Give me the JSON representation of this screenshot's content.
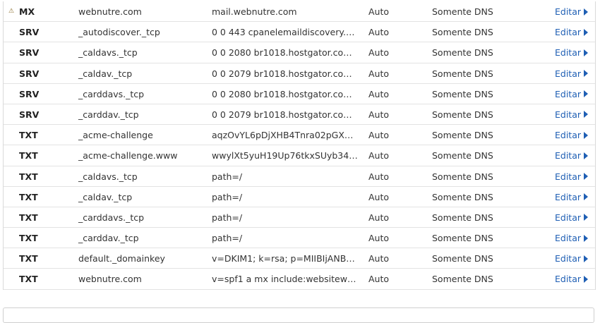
{
  "dns_table": {
    "edit_label": "Editar",
    "warning_icon": "⚠",
    "rows": [
      {
        "warning": true,
        "type": "MX",
        "name": "webnutre.com",
        "value": "mail.webnutre.com",
        "ttl": "Auto",
        "status": "Somente DNS"
      },
      {
        "warning": false,
        "type": "SRV",
        "name": "_autodiscover._tcp",
        "value": "0 0 443 cpanelemaildiscovery.cpa...",
        "ttl": "Auto",
        "status": "Somente DNS"
      },
      {
        "warning": false,
        "type": "SRV",
        "name": "_caldavs._tcp",
        "value": "0 0 2080 br1018.hostgator.com.br",
        "ttl": "Auto",
        "status": "Somente DNS"
      },
      {
        "warning": false,
        "type": "SRV",
        "name": "_caldav._tcp",
        "value": "0 0 2079 br1018.hostgator.com.br",
        "ttl": "Auto",
        "status": "Somente DNS"
      },
      {
        "warning": false,
        "type": "SRV",
        "name": "_carddavs._tcp",
        "value": "0 0 2080 br1018.hostgator.com.br",
        "ttl": "Auto",
        "status": "Somente DNS"
      },
      {
        "warning": false,
        "type": "SRV",
        "name": "_carddav._tcp",
        "value": "0 0 2079 br1018.hostgator.com.br",
        "ttl": "Auto",
        "status": "Somente DNS"
      },
      {
        "warning": false,
        "type": "TXT",
        "name": "_acme-challenge",
        "value": "aqzOvYL6pDjXHB4Tnra02pGXK_1...",
        "ttl": "Auto",
        "status": "Somente DNS"
      },
      {
        "warning": false,
        "type": "TXT",
        "name": "_acme-challenge.www",
        "value": "wwylXt5yuH19Up76tkxSUyb346h...",
        "ttl": "Auto",
        "status": "Somente DNS"
      },
      {
        "warning": false,
        "type": "TXT",
        "name": "_caldavs._tcp",
        "value": "path=/",
        "ttl": "Auto",
        "status": "Somente DNS"
      },
      {
        "warning": false,
        "type": "TXT",
        "name": "_caldav._tcp",
        "value": "path=/",
        "ttl": "Auto",
        "status": "Somente DNS"
      },
      {
        "warning": false,
        "type": "TXT",
        "name": "_carddavs._tcp",
        "value": "path=/",
        "ttl": "Auto",
        "status": "Somente DNS"
      },
      {
        "warning": false,
        "type": "TXT",
        "name": "_carddav._tcp",
        "value": "path=/",
        "ttl": "Auto",
        "status": "Somente DNS"
      },
      {
        "warning": false,
        "type": "TXT",
        "name": "default._domainkey",
        "value": "v=DKIM1; k=rsa; p=MIIBIjANBgk...",
        "ttl": "Auto",
        "status": "Somente DNS"
      },
      {
        "warning": false,
        "type": "TXT",
        "name": "webnutre.com",
        "value": "v=spf1 a mx include:websitewelc...",
        "ttl": "Auto",
        "status": "Somente DNS"
      }
    ]
  },
  "colors": {
    "link": "#1f5fb4",
    "row_border": "#e3e3e3",
    "warning": "#8a6d2b"
  }
}
